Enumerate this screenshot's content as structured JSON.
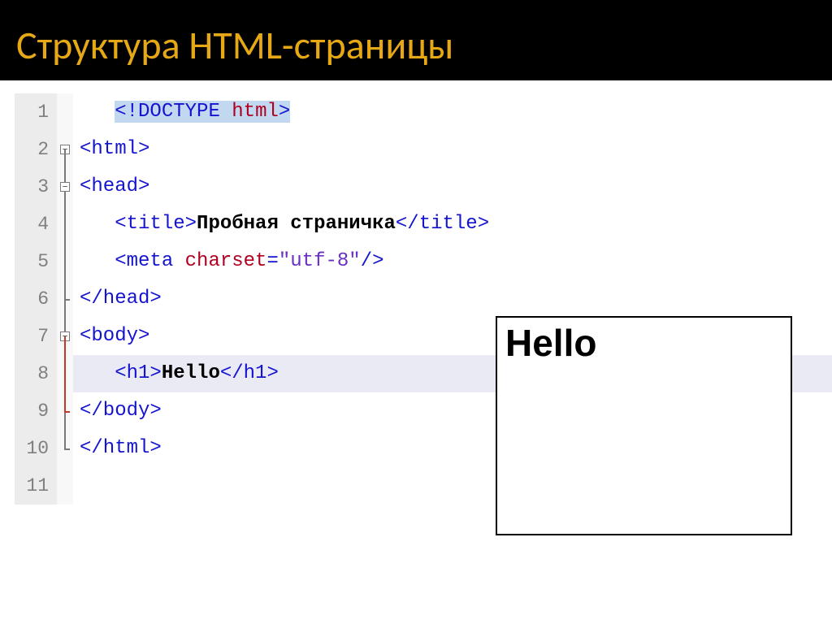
{
  "header": {
    "title": "Структура HTML-страницы"
  },
  "code": {
    "line_numbers": [
      "1",
      "2",
      "3",
      "4",
      "5",
      "6",
      "7",
      "8",
      "9",
      "10",
      "11"
    ],
    "line1": {
      "open": "<",
      "excl": "!",
      "kw": "DOCTYPE",
      "arg": "html",
      "close": ">"
    },
    "line2": {
      "tag": "<html>"
    },
    "line3": {
      "tag": "<head>"
    },
    "line4": {
      "open": "<title>",
      "text": "Пробная страничка",
      "close": "</title>"
    },
    "line5": {
      "open": "<meta ",
      "attr": "charset",
      "eq": "=",
      "val": "\"utf-8\"",
      "close": "/>"
    },
    "line6": {
      "tag": "</head>"
    },
    "line7": {
      "tag": "<body>"
    },
    "line8": {
      "open": "<h1>",
      "text": "Hello",
      "close": "</h1>"
    },
    "line9": {
      "tag": "</body>"
    },
    "line10": {
      "tag": "</html>"
    }
  },
  "preview": {
    "heading": "Hello"
  }
}
